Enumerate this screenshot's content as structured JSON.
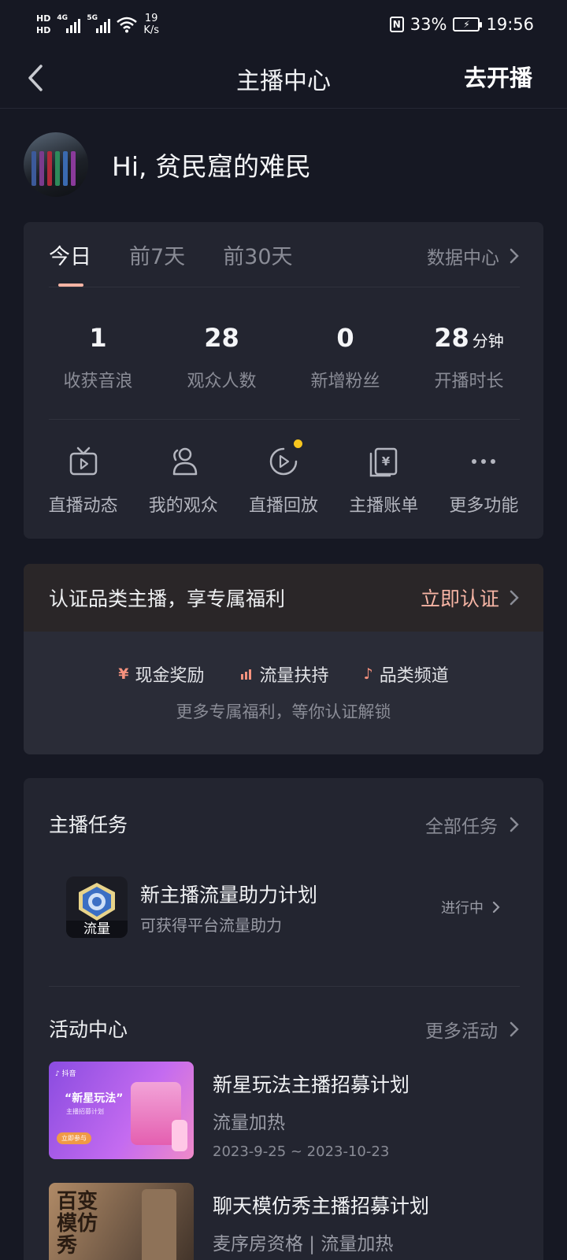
{
  "status_bar": {
    "hd1": "HD",
    "hd2": "HD",
    "net1": "4G",
    "net2": "5G",
    "speed_value": "19",
    "speed_unit": "K/s",
    "nfc": "N",
    "battery": "33%",
    "time": "19:56"
  },
  "nav": {
    "title": "主播中心",
    "action": "去开播"
  },
  "profile": {
    "greeting": "Hi, 贫民窟的难民"
  },
  "stats_card": {
    "tabs": [
      "今日",
      "前7天",
      "前30天"
    ],
    "active_tab": "今日",
    "data_center": "数据中心",
    "stats": [
      {
        "value": "1",
        "unit": "",
        "label": "收获音浪"
      },
      {
        "value": "28",
        "unit": "",
        "label": "观众人数"
      },
      {
        "value": "0",
        "unit": "",
        "label": "新增粉丝"
      },
      {
        "value": "28",
        "unit": "分钟",
        "label": "开播时长"
      }
    ],
    "tools": [
      {
        "label": "直播动态",
        "icon": "tv-play-icon"
      },
      {
        "label": "我的观众",
        "icon": "audience-icon"
      },
      {
        "label": "直播回放",
        "icon": "replay-icon"
      },
      {
        "label": "主播账单",
        "icon": "bill-icon"
      },
      {
        "label": "更多功能",
        "icon": "more-icon"
      }
    ]
  },
  "certification": {
    "title": "认证品类主播，享专属福利",
    "link": "立即认证",
    "perks": [
      {
        "icon": "yen-icon",
        "label": "现金奖励"
      },
      {
        "icon": "traffic-bars-icon",
        "label": "流量扶持"
      },
      {
        "icon": "music-note-icon",
        "label": "品类频道"
      }
    ],
    "subtitle": "更多专属福利，等你认证解锁"
  },
  "tasks": {
    "title": "主播任务",
    "link": "全部任务",
    "items": [
      {
        "name": "新主播流量助力计划",
        "desc": "可获得平台流量助力",
        "badge": "流量",
        "status": "进行中"
      }
    ]
  },
  "activities": {
    "title": "活动中心",
    "link": "更多活动",
    "items": [
      {
        "name": "新星玩法主播招募计划",
        "tags": "流量加热",
        "date": "2023-9-25 ~ 2023-10-23",
        "thumb_text": "“新星玩法”",
        "thumb_sub": "主播招募计划",
        "thumb_btn": "立即参与"
      },
      {
        "name": "聊天模仿秀主播招募计划",
        "tags": "麦序房资格 | 流量加热",
        "date": "",
        "thumb_text": "百变模仿秀"
      }
    ]
  },
  "colors": {
    "background": "#161823",
    "card": "#232530",
    "accent": "#f6b4a4",
    "notification_dot": "#f7c51e"
  }
}
